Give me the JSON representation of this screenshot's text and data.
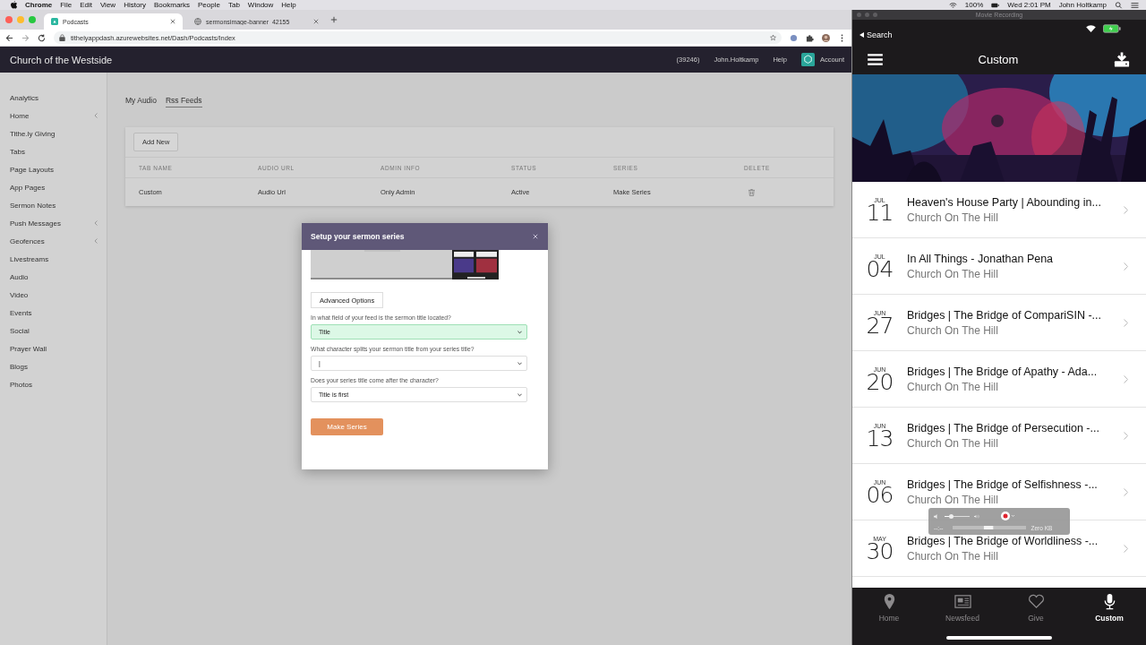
{
  "menu_bar": {
    "app": "Chrome",
    "items": [
      "File",
      "Edit",
      "View",
      "History",
      "Bookmarks",
      "People",
      "Tab",
      "Window",
      "Help"
    ],
    "battery": "100%",
    "clock": "Wed 2:01 PM",
    "user": "John Holtkamp"
  },
  "browser": {
    "tabs": [
      {
        "title": "Podcasts",
        "selected": true
      },
      {
        "title": "sermonsimage-banner_42155",
        "selected": false
      }
    ],
    "url": "tithelyappdash.azurewebsites.net/Dash/Podcasts/Index"
  },
  "header": {
    "brand": "Church of the Westside",
    "account_id": "(39246)",
    "user": "John.Holtkamp",
    "help": "Help",
    "account": "Account"
  },
  "sidebar": {
    "items": [
      {
        "label": "Analytics",
        "submenu": false
      },
      {
        "label": "Home",
        "submenu": true
      },
      {
        "label": "Tithe.ly Giving",
        "submenu": false
      },
      {
        "label": "Tabs",
        "submenu": false
      },
      {
        "label": "Page Layouts",
        "submenu": false
      },
      {
        "label": "App Pages",
        "submenu": false
      },
      {
        "label": "Sermon Notes",
        "submenu": false
      },
      {
        "label": "Push Messages",
        "submenu": true
      },
      {
        "label": "Geofences",
        "submenu": true
      },
      {
        "label": "Livestreams",
        "submenu": false
      },
      {
        "label": "Audio",
        "submenu": false
      },
      {
        "label": "Video",
        "submenu": false
      },
      {
        "label": "Events",
        "submenu": false
      },
      {
        "label": "Social",
        "submenu": false
      },
      {
        "label": "Prayer Wall",
        "submenu": false
      },
      {
        "label": "Blogs",
        "submenu": false
      },
      {
        "label": "Photos",
        "submenu": false
      }
    ]
  },
  "page_tabs": [
    {
      "label": "My Audio",
      "selected": false
    },
    {
      "label": "Rss Feeds",
      "selected": true
    }
  ],
  "table": {
    "add_button": "Add New",
    "columns": [
      "TAB NAME",
      "AUDIO URL",
      "ADMIN INFO",
      "STATUS",
      "SERIES",
      "DELETE"
    ],
    "rows": [
      {
        "tab_name": "Custom",
        "audio_url": "Audio Url",
        "admin_info": "Only Admin",
        "status": "Active",
        "series": "Make Series"
      }
    ]
  },
  "modal": {
    "title": "Setup your sermon series",
    "advanced_button": "Advanced Options",
    "fields": [
      {
        "label": "In what field of your feed is the sermon title located?",
        "value": "Title",
        "focused": true
      },
      {
        "label": "What character splits your sermon title from your series title?",
        "value": "|",
        "focused": false
      },
      {
        "label": "Does your series title come after the character?",
        "value": "Title is first",
        "focused": false
      }
    ],
    "submit": "Make Series"
  },
  "recording": {
    "window_title": "Movie Recording",
    "elapsed": "--:--",
    "size": "Zero KB",
    "level": 0.25
  },
  "phone": {
    "back_label": "Search",
    "title": "Custom",
    "sermons": [
      {
        "month": "JUL",
        "day": "11",
        "title": "Heaven's House Party | Abounding in...",
        "church": "Church On The Hill"
      },
      {
        "month": "JUL",
        "day": "04",
        "title": "In All Things - Jonathan Pena",
        "church": "Church On The Hill"
      },
      {
        "month": "JUN",
        "day": "27",
        "title": "Bridges | The Bridge of CompariSIN -...",
        "church": "Church On The Hill"
      },
      {
        "month": "JUN",
        "day": "20",
        "title": "Bridges | The Bridge of Apathy - Ada...",
        "church": "Church On The Hill"
      },
      {
        "month": "JUN",
        "day": "13",
        "title": "Bridges | The Bridge of Persecution -...",
        "church": "Church On The Hill"
      },
      {
        "month": "JUN",
        "day": "06",
        "title": "Bridges | The Bridge of Selfishness -...",
        "church": "Church On The Hill"
      },
      {
        "month": "MAY",
        "day": "30",
        "title": "Bridges | The Bridge of Worldliness -...",
        "church": "Church On The Hill"
      }
    ],
    "tabs": [
      {
        "label": "Home",
        "kind": "pin",
        "selected": false
      },
      {
        "label": "Newsfeed",
        "kind": "news",
        "selected": false
      },
      {
        "label": "Give",
        "kind": "heart",
        "selected": false
      },
      {
        "label": "Custom",
        "kind": "mic",
        "selected": true
      }
    ]
  }
}
